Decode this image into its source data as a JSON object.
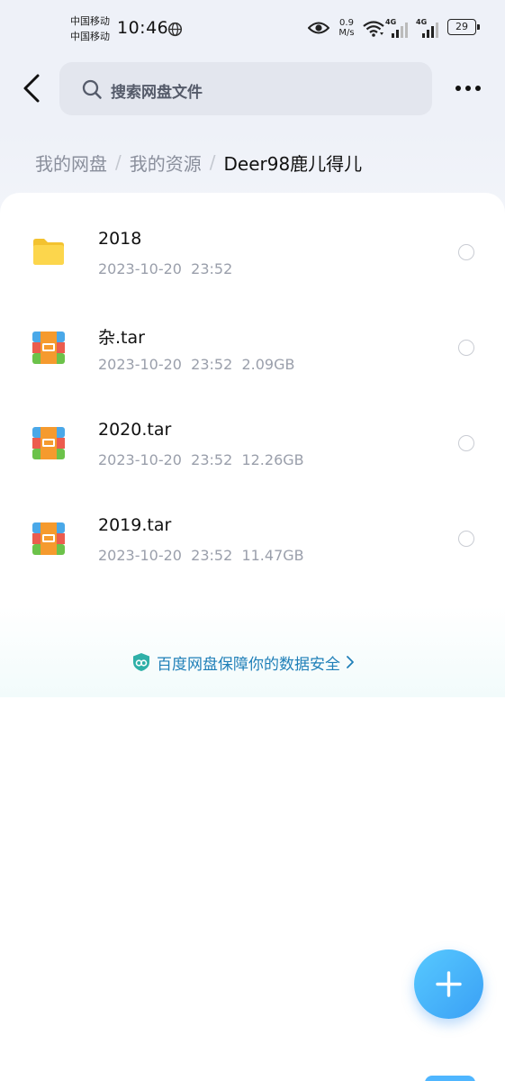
{
  "status_bar": {
    "carrier_1": "中国移动",
    "carrier_2": "中国移动",
    "time": "10:46",
    "speed_value": "0.9",
    "speed_unit": "M/s",
    "net_1": "4G",
    "net_2": "4G",
    "battery": "29"
  },
  "search": {
    "placeholder": "搜索网盘文件"
  },
  "breadcrumb": {
    "items": [
      "我的网盘",
      "我的资源",
      "Deer98鹿儿得儿"
    ],
    "separator": "/"
  },
  "files": [
    {
      "name": "2018",
      "meta": "2023-10-20  23:52",
      "icon": "folder-icon"
    },
    {
      "name": "杂.tar",
      "meta": "2023-10-20  23:52  2.09GB",
      "icon": "archive-icon"
    },
    {
      "name": "2020.tar",
      "meta": "2023-10-20  23:52  12.26GB",
      "icon": "archive-icon"
    },
    {
      "name": "2019.tar",
      "meta": "2023-10-20  23:52  11.47GB",
      "icon": "archive-icon"
    }
  ],
  "safety_banner": {
    "text": "百度网盘保障你的数据安全"
  },
  "colors": {
    "accent": "#3aa0f5",
    "folder": "#fbd44a",
    "safety_text": "#1f7fb8"
  }
}
